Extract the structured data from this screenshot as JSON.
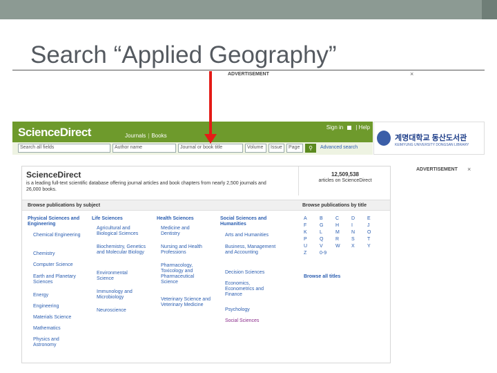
{
  "slide": {
    "title": "Search “Applied Geography”"
  },
  "advert": {
    "top_label": "ADVERTISEMENT",
    "right_label": "ADVERTISEMENT",
    "close_glyph": "×"
  },
  "header": {
    "logo": "ScienceDirect",
    "nav": [
      "Journals",
      "Books"
    ],
    "sign_in": "Sign in",
    "help": "Help"
  },
  "search": {
    "fields": [
      "Search all fields",
      "Author name",
      "Journal or book title",
      "Volume",
      "Issue",
      "Page"
    ],
    "go_icon": "search-icon",
    "advanced": "Advanced search"
  },
  "library": {
    "name": "계명대학교 동산도서관",
    "subtitle": "KEIMYUNG UNIVERSITY DONGSAN LIBRARY"
  },
  "intro": {
    "title": "ScienceDirect",
    "text": "is a leading full-text scientific database offering journal articles and book chapters from nearly 2,500 journals and 26,000 books.",
    "stats_number": "12,509,538",
    "stats_label": "articles on ScienceDirect"
  },
  "browse": {
    "by_subject": "Browse publications by subject",
    "by_title": "Browse publications by title",
    "browse_all": "Browse all titles",
    "columns": [
      {
        "heading": "Physical Sciences and Engineering",
        "items": [
          "Chemical Engineering",
          "Chemistry",
          "Computer Science",
          "Earth and Planetary Sciences",
          "Energy",
          "Engineering",
          "Materials Science",
          "Mathematics",
          "Physics and Astronomy"
        ]
      },
      {
        "heading": "Life Sciences",
        "items": [
          "Agricultural and Biological Sciences",
          "Biochemistry, Genetics and Molecular Biology",
          "Environmental Science",
          "Immunology and Microbiology",
          "Neuroscience"
        ]
      },
      {
        "heading": "Health Sciences",
        "items": [
          "Medicine and Dentistry",
          "Nursing and Health Professions",
          "Pharmacology, Toxicology and Pharmaceutical Science",
          "Veterinary Science and Veterinary Medicine"
        ]
      },
      {
        "heading": "Social Sciences and Humanities",
        "items": [
          "Arts and Humanities",
          "Business, Management and Accounting",
          "Decision Sciences",
          "Economics, Econometrics and Finance",
          "Psychology",
          "Social Sciences"
        ]
      }
    ],
    "letters": [
      [
        "A",
        "B",
        "C",
        "D",
        "E"
      ],
      [
        "F",
        "G",
        "H",
        "I",
        "J"
      ],
      [
        "K",
        "L",
        "M",
        "N",
        "O"
      ],
      [
        "P",
        "Q",
        "R",
        "S",
        "T"
      ],
      [
        "U",
        "V",
        "W",
        "X",
        "Y"
      ],
      [
        "Z",
        "0-9"
      ]
    ]
  },
  "colors": {
    "brand_green": "#6e9a2c",
    "link_blue": "#2a5db0",
    "arrow_red": "#e41b17",
    "visited_purple": "#8a2b8a"
  }
}
